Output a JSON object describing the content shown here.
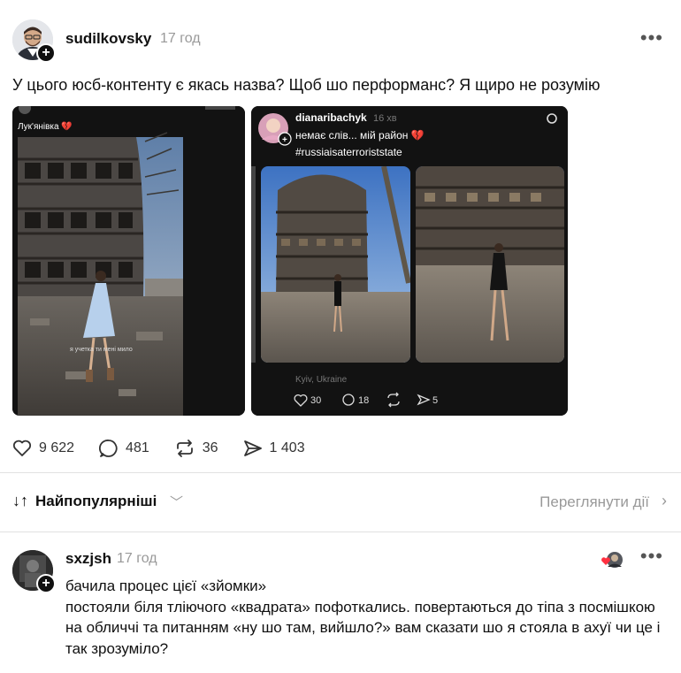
{
  "post": {
    "username": "sudilkovsky",
    "time": "17 год",
    "text": "У цього юсб-контенту є якась назва? Щоб шо перформанс? Я щиро не розумію",
    "media_left": {
      "location_label": "Лук'янівка 💔",
      "caption_overlay": "я учетка ти мені мило"
    },
    "embedded_post": {
      "username": "dianaribachyk",
      "time": "16 хв",
      "text_line1": "немає слів... мій район 💔",
      "text_line2": "#russiaisaterroriststate",
      "location": "Kyiv, Ukraine",
      "likes": "30",
      "replies": "18",
      "shares": "5"
    },
    "stats": {
      "likes": "9 622",
      "replies": "481",
      "reposts": "36",
      "shares": "1 403"
    }
  },
  "sort": {
    "label": "Найпопулярніші",
    "view_activity": "Переглянути дії"
  },
  "comment": {
    "username": "sxzjsh",
    "time": "17 год",
    "line1": "бачила процес цієї «зйомки»",
    "line2": "постояли біля тліючого «квадрата» пофоткались. повертаються до тіпа з посмішкою на обличчі та питанням «ну шо там, вийшло?» вам сказати шо я стояла в ахуї чи це і так зрозуміло?"
  },
  "icons": {
    "more": "more-horizontal-icon",
    "heart": "heart-icon",
    "reply": "comment-icon",
    "repost": "repost-icon",
    "share": "send-icon",
    "sort": "sort-arrows-icon",
    "chevron": "chevron-down-icon",
    "threads": "threads-logo-icon"
  },
  "colors": {
    "text": "#101010",
    "muted": "#999999",
    "like_red": "#ff3040"
  }
}
